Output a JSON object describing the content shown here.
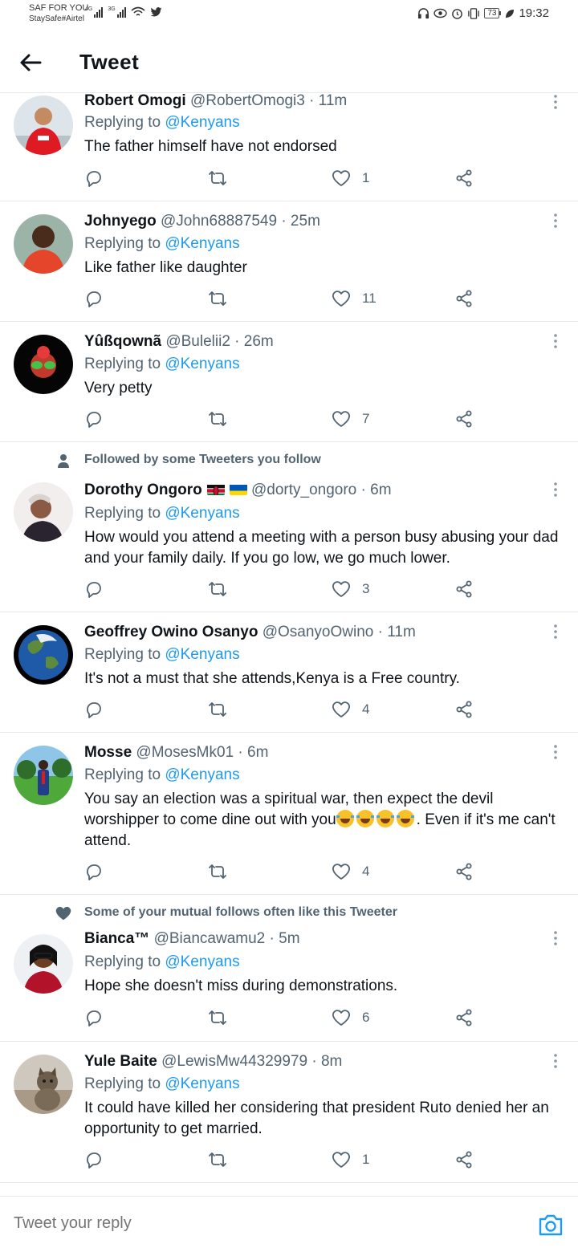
{
  "status_bar": {
    "carrier_line1": "SAF FOR YOU",
    "carrier_line2": "StaySafe#Airtel",
    "net1": "4G",
    "net2": "3G",
    "battery": "73",
    "time": "19:32"
  },
  "header": {
    "title": "Tweet"
  },
  "tweets": [
    {
      "name": "Robert Omogi",
      "handle": "@RobertOmogi3",
      "time": "· 11m",
      "replying_prefix": "Replying to ",
      "replying_to": "@Kenyans",
      "text": "The father himself have not endorsed",
      "likes": "1"
    },
    {
      "name": "Johnyego",
      "handle": "@John68887549",
      "time": "· 25m",
      "replying_prefix": "Replying to ",
      "replying_to": "@Kenyans",
      "text": "Like father like daughter",
      "likes": "11"
    },
    {
      "name": "Yûßqownã",
      "handle": "@Bulelii2",
      "time": "· 26m",
      "replying_prefix": "Replying to ",
      "replying_to": "@Kenyans",
      "text": "Very petty",
      "likes": "7"
    },
    {
      "social_context": "Followed by some Tweeters you follow",
      "name": "Dorothy Ongoro",
      "handle": "@dorty_ongoro",
      "time": "· 6m",
      "replying_prefix": "Replying to ",
      "replying_to": "@Kenyans",
      "text": "How would you attend a meeting with a person busy abusing your dad and your family daily. If you go low, we go much lower.",
      "likes": "3"
    },
    {
      "name": "Geoffrey Owino Osanyo",
      "handle": "@OsanyoOwino",
      "time": "· 11m",
      "replying_prefix": "Replying to ",
      "replying_to": "@Kenyans",
      "text": "It's not a must that she attends,Kenya is a Free country.",
      "likes": "4"
    },
    {
      "name": "Mosse",
      "handle": "@MosesMk01",
      "time": "· 6m",
      "replying_prefix": "Replying to ",
      "replying_to": "@Kenyans",
      "text_before": "You say an election was a spiritual war, then expect the devil worshipper to come dine out with you",
      "text_after": ". Even if it's me can't attend.",
      "likes": "4"
    },
    {
      "social_context": "Some of your mutual follows often like this Tweeter",
      "name": "Bianca™",
      "handle": "@Biancawamu2",
      "time": "· 5m",
      "replying_prefix": "Replying to ",
      "replying_to": "@Kenyans",
      "text": "Hope she doesn't miss during demonstrations.",
      "likes": "6"
    },
    {
      "name": "Yule Baite",
      "handle": "@LewisMw44329979",
      "time": "· 8m",
      "replying_prefix": "Replying to ",
      "replying_to": "@Kenyans",
      "text": "It could have killed her considering that president Ruto denied her an opportunity to get married.",
      "likes": "1"
    }
  ],
  "reply_bar": {
    "placeholder": "Tweet your reply"
  }
}
